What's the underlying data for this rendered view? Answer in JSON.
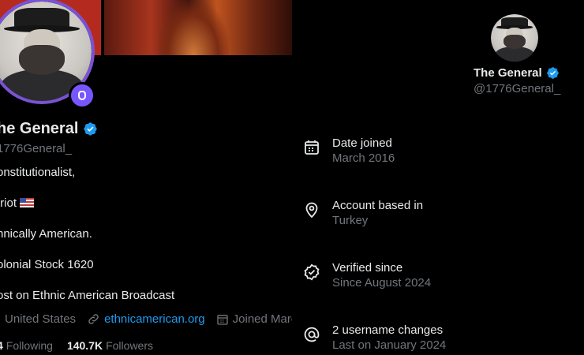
{
  "profile": {
    "display_name": "he General",
    "handle": "1776General_",
    "bio_lines": [
      "onstitutionalist,",
      "triot",
      "hnically American.",
      "olonial Stock 1620",
      "ost on Ethnic American Broadcast"
    ],
    "location": "United States",
    "website": "ethnicamerican.org",
    "joined": "Joined Marc",
    "following_count": "4",
    "following_label": "Following",
    "followers_count": "140.7K",
    "followers_label": "Followers",
    "icons": {
      "verified": "verified-badge-icon",
      "spaces": "microphone-icon",
      "location": "location-pin-icon",
      "link": "link-icon",
      "calendar": "calendar-icon",
      "flag": "us-flag-emoji"
    }
  },
  "about": {
    "name": "The General",
    "handle": "@1776General_",
    "items": [
      {
        "icon": "calendar-icon",
        "title": "Date joined",
        "value": "March 2016"
      },
      {
        "icon": "location-pin-icon",
        "title": "Account based in",
        "value": "Turkey"
      },
      {
        "icon": "verified-check-icon",
        "title": "Verified since",
        "value": "Since August 2024"
      },
      {
        "icon": "at-sign-icon",
        "title": "2 username changes",
        "value": "Last on January 2024"
      }
    ]
  },
  "colors": {
    "background": "#000000",
    "text_primary": "#e7e9ea",
    "text_secondary": "#71767b",
    "link": "#1d9bf0",
    "verified": "#1d9bf0",
    "spaces_purple": "#7856ff"
  }
}
